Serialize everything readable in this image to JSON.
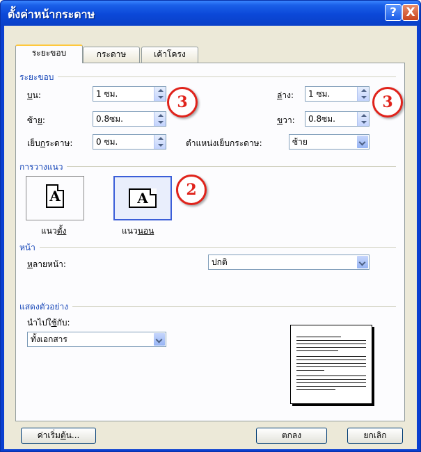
{
  "title": "ตั้งค่าหน้ากระดาษ",
  "titlebar": {
    "help_glyph": "?",
    "close_glyph": "X"
  },
  "tabs": [
    {
      "label": "ระยะขอบ",
      "active": true
    },
    {
      "label": "กระดาษ",
      "active": false
    },
    {
      "label": "เค้าโครง",
      "active": false
    }
  ],
  "margins": {
    "section": "ระยะขอบ",
    "top_label_prefix": "",
    "top_label_u": "บ",
    "top_label_suffix": "น:",
    "top_value": "1 ซม.",
    "bottom_label_u": "ล",
    "bottom_label_suffix": "่าง:",
    "bottom_value": "1 ซม.",
    "left_label_prefix": "ซ้า",
    "left_label_u": "ย",
    "left_label_suffix": ":",
    "left_value": "0.8ซม.",
    "right_label_u": "ข",
    "right_label_suffix": "วา:",
    "right_value": "0.8ซม.",
    "gutter_label_prefix": "เย็บ",
    "gutter_label_u": "ก",
    "gutter_label_suffix": "ระดาษ:",
    "gutter_value": "0 ซม.",
    "gutter_pos_label": "ตำแหน่งเย็บกระดาษ:",
    "gutter_pos_value": "ซ้าย"
  },
  "orientation": {
    "section": "การวางแนว",
    "portrait_prefix": "แนว",
    "portrait_u": "ตั้ง",
    "landscape_prefix": "แนว",
    "landscape_u": "นอน",
    "selected": "landscape",
    "glyph": "A"
  },
  "pages": {
    "section": "หน้า",
    "multiple_label_u": "ห",
    "multiple_label_suffix": "ลายหน้า:",
    "multiple_value": "ปกติ"
  },
  "preview": {
    "section": "แสดงตัวอย่าง",
    "apply_label_prefix": "นำไปใ",
    "apply_label_u": "ช้",
    "apply_label_suffix": "กับ:",
    "apply_value": "ทั้งเอกสาร"
  },
  "callouts": [
    "3",
    "3",
    "2"
  ],
  "buttons": {
    "default_prefix": "ค่าเริ่ม",
    "default_u": "ต้",
    "default_suffix": "น...",
    "ok": "ตกลง",
    "cancel": "ยกเลิก"
  },
  "colors": {
    "titlebar": "#0b48d8",
    "section_label": "#1646b8",
    "callout": "#e0231b",
    "selected_orientation": "#3b5ed8"
  }
}
